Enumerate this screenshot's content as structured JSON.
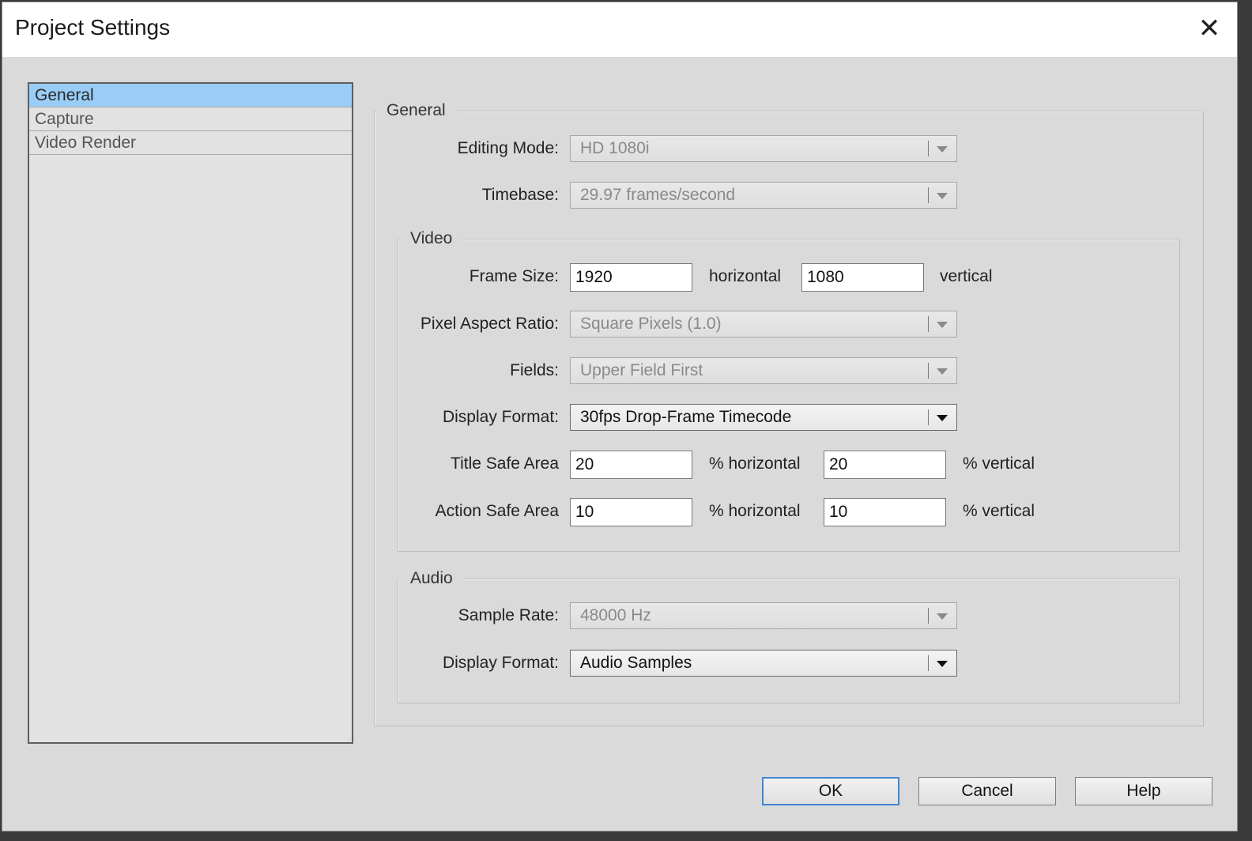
{
  "window": {
    "title": "Project Settings",
    "close_icon": "✕"
  },
  "nav": {
    "items": [
      {
        "label": "General",
        "selected": true
      },
      {
        "label": "Capture",
        "selected": false
      },
      {
        "label": "Video Render",
        "selected": false
      }
    ]
  },
  "general": {
    "legend": "General",
    "editing_mode": {
      "label": "Editing Mode:",
      "value": "HD 1080i",
      "enabled": false
    },
    "timebase": {
      "label": "Timebase:",
      "value": "29.97 frames/second",
      "enabled": false
    }
  },
  "video": {
    "legend": "Video",
    "frame_size": {
      "label": "Frame Size:",
      "horizontal_value": "1920",
      "horizontal_label": "horizontal",
      "vertical_value": "1080",
      "vertical_label": "vertical"
    },
    "pixel_aspect_ratio": {
      "label": "Pixel Aspect Ratio:",
      "value": "Square Pixels (1.0)",
      "enabled": false
    },
    "fields": {
      "label": "Fields:",
      "value": "Upper Field First",
      "enabled": false
    },
    "display_format": {
      "label": "Display Format:",
      "value": "30fps Drop-Frame Timecode",
      "enabled": true
    },
    "title_safe": {
      "label": "Title Safe Area",
      "horizontal_value": "20",
      "horizontal_label": "% horizontal",
      "vertical_value": "20",
      "vertical_label": "% vertical"
    },
    "action_safe": {
      "label": "Action Safe Area",
      "horizontal_value": "10",
      "horizontal_label": "% horizontal",
      "vertical_value": "10",
      "vertical_label": "% vertical"
    }
  },
  "audio": {
    "legend": "Audio",
    "sample_rate": {
      "label": "Sample Rate:",
      "value": "48000 Hz",
      "enabled": false
    },
    "display_format": {
      "label": "Display Format:",
      "value": "Audio Samples",
      "enabled": true
    }
  },
  "buttons": {
    "ok": "OK",
    "cancel": "Cancel",
    "help": "Help"
  },
  "colors": {
    "selection": "#99cdf7",
    "dialog_bg": "#dadada",
    "default_button_border": "#3f86d4"
  }
}
